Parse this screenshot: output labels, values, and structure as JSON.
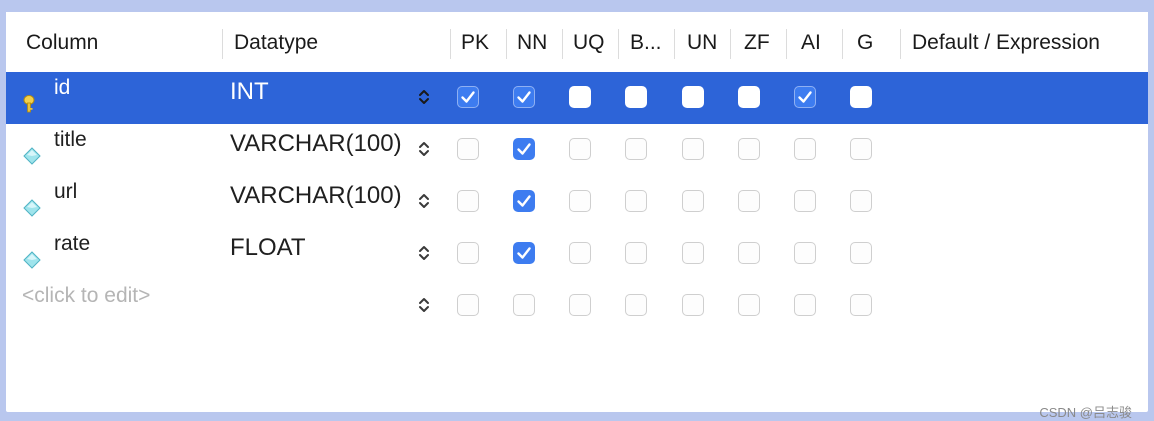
{
  "columns_header": {
    "column": "Column",
    "datatype": "Datatype",
    "pk": "PK",
    "nn": "NN",
    "uq": "UQ",
    "b": "B...",
    "un": "UN",
    "zf": "ZF",
    "ai": "AI",
    "g": "G",
    "default": "Default / Expression"
  },
  "rows": [
    {
      "name": "id",
      "datatype": "INT",
      "selected": true,
      "icon": "primary-key-icon",
      "flags": {
        "pk": true,
        "nn": true,
        "uq": false,
        "b": false,
        "un": false,
        "zf": false,
        "ai": true,
        "g": false
      }
    },
    {
      "name": "title",
      "datatype": "VARCHAR(100)",
      "selected": false,
      "icon": "column-diamond-icon",
      "flags": {
        "pk": false,
        "nn": true,
        "uq": false,
        "b": false,
        "un": false,
        "zf": false,
        "ai": false,
        "g": false
      }
    },
    {
      "name": "url",
      "datatype": "VARCHAR(100)",
      "selected": false,
      "icon": "column-diamond-icon",
      "flags": {
        "pk": false,
        "nn": true,
        "uq": false,
        "b": false,
        "un": false,
        "zf": false,
        "ai": false,
        "g": false
      }
    },
    {
      "name": "rate",
      "datatype": "FLOAT",
      "selected": false,
      "icon": "column-diamond-icon",
      "flags": {
        "pk": false,
        "nn": true,
        "uq": false,
        "b": false,
        "un": false,
        "zf": false,
        "ai": false,
        "g": false
      }
    }
  ],
  "new_row": {
    "placeholder": "<click to edit>"
  },
  "watermark": "CSDN @吕志骏",
  "colors": {
    "selection": "#2d64d8",
    "checkbox_checked": "#3d7cf0",
    "frame": "#b9c7ee"
  }
}
